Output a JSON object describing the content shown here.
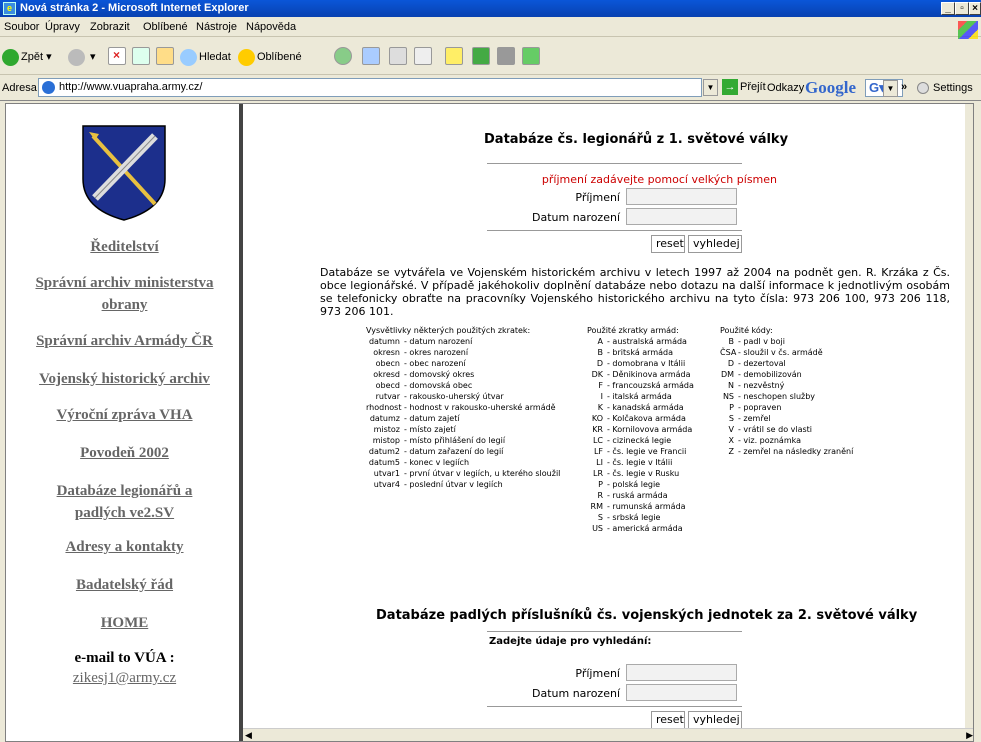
{
  "window": {
    "title": "Nová stránka 2 - Microsoft Internet Explorer",
    "controls": [
      "_",
      "▫",
      "×"
    ]
  },
  "menu": [
    "Soubor",
    "Úpravy",
    "Zobrazit",
    "Oblíbené",
    "Nástroje",
    "Nápověda"
  ],
  "toolbar": {
    "back": "Zpět",
    "search": "Hledat",
    "favorites": "Oblíbené"
  },
  "address": {
    "label": "Adresa",
    "url": "http://www.vuapraha.army.cz/",
    "go": "Přejít",
    "links": "Odkazy",
    "google_brand": "Google",
    "google_g": "G",
    "settings": "Settings"
  },
  "sidebar": {
    "links": [
      "Ředitelství",
      "Správní archiv ministerstva obrany",
      "Správní archiv Armády ČR",
      "Vojenský historický archiv",
      "Výroční zpráva VHA",
      "Povodeň 2002",
      "Databáze legionářů a padlých ve2.SV",
      "Adresy a kontakty",
      "Badatelský řád",
      "HOME"
    ],
    "email_heading": "e-mail to VÚA :",
    "email": "zikesj1@army.cz"
  },
  "form1": {
    "title": "Databáze čs. legionářů z 1. světové války",
    "hint": "příjmení zadávejte pomocí velkých písmen",
    "surname_label": "Příjmení",
    "birth_label": "Datum narození",
    "reset": "reset",
    "search": "vyhledej"
  },
  "intro": "Databáze se vytvářela ve Vojenském historickém archivu v letech 1997 až 2004 na podnět gen. R. Krzáka z Čs. obce legionářské. V případě jakéhokoliv doplnění databáze nebo dotazu na další informace k jednotlivým osobám se telefonicky obraťte na pracovníky Vojenského historického archivu na tyto čísla: 973 206 100, 973 206 118, 973 206 101.",
  "abbrev": {
    "heading": "Vysvětlivky některých použitých zkratek:",
    "rows": [
      [
        "datumn",
        "- datum narození"
      ],
      [
        "okresn",
        "- okres narození"
      ],
      [
        "obecn",
        "- obec narození"
      ],
      [
        "okresd",
        "- domovský okres"
      ],
      [
        "obecd",
        "- domovská obec"
      ],
      [
        "rutvar",
        "- rakousko-uherský útvar"
      ],
      [
        "rhodnost",
        "- hodnost v rakousko-uherské armádě"
      ],
      [
        "datumz",
        "- datum zajetí"
      ],
      [
        "mistoz",
        "- místo zajetí"
      ],
      [
        "mistop",
        "- místo přihlášení do legií"
      ],
      [
        "datum2",
        "- datum zařazení do legií"
      ],
      [
        "datum5",
        "- konec v legiích"
      ],
      [
        "utvar1",
        "- první útvar v legiích, u kterého sloužil"
      ],
      [
        "utvar4",
        "- poslední útvar v legiích"
      ]
    ]
  },
  "armies": {
    "heading": "Použité zkratky armád:",
    "rows": [
      [
        "A",
        "- australská armáda"
      ],
      [
        "B",
        "- britská armáda"
      ],
      [
        "D",
        "- domobrana v Itálii"
      ],
      [
        "DK",
        "- Děnikinova armáda"
      ],
      [
        "F",
        "- francouzská armáda"
      ],
      [
        "I",
        "- italská armáda"
      ],
      [
        "K",
        "- kanadská armáda"
      ],
      [
        "KO",
        "- Kolčakova armáda"
      ],
      [
        "KR",
        "- Kornilovova armáda"
      ],
      [
        "LC",
        "- cizinecká legie"
      ],
      [
        "LF",
        "- čs. legie ve Francii"
      ],
      [
        "LI",
        "- čs. legie v Itálii"
      ],
      [
        "LR",
        "- čs. legie v Rusku"
      ],
      [
        "P",
        "- polská legie"
      ],
      [
        "R",
        "- ruská armáda"
      ],
      [
        "RM",
        "- rumunská armáda"
      ],
      [
        "S",
        "- srbská legie"
      ],
      [
        "US",
        "- americká armáda"
      ]
    ]
  },
  "codes": {
    "heading": "Použité kódy:",
    "rows": [
      [
        "B",
        "- padl v boji"
      ],
      [
        "ČSA",
        "- sloužil v čs. armádě"
      ],
      [
        "D",
        "- dezertoval"
      ],
      [
        "DM",
        "- demobilizován"
      ],
      [
        "N",
        "- nezvěstný"
      ],
      [
        "NS",
        "- neschopen služby"
      ],
      [
        "P",
        "- popraven"
      ],
      [
        "S",
        "- zemřel"
      ],
      [
        "V",
        "- vrátil se do vlasti"
      ],
      [
        "X",
        "- viz. poznámka"
      ],
      [
        "Z",
        "- zemřel na následky zranění"
      ]
    ]
  },
  "form2": {
    "title": "Databáze padlých příslušníků čs. vojenských jednotek za 2. světové války",
    "subtitle": "Zadejte údaje pro vyhledání:",
    "surname_label": "Příjmení",
    "birth_label": "Datum narození",
    "reset": "reset",
    "search": "vyhledej"
  }
}
